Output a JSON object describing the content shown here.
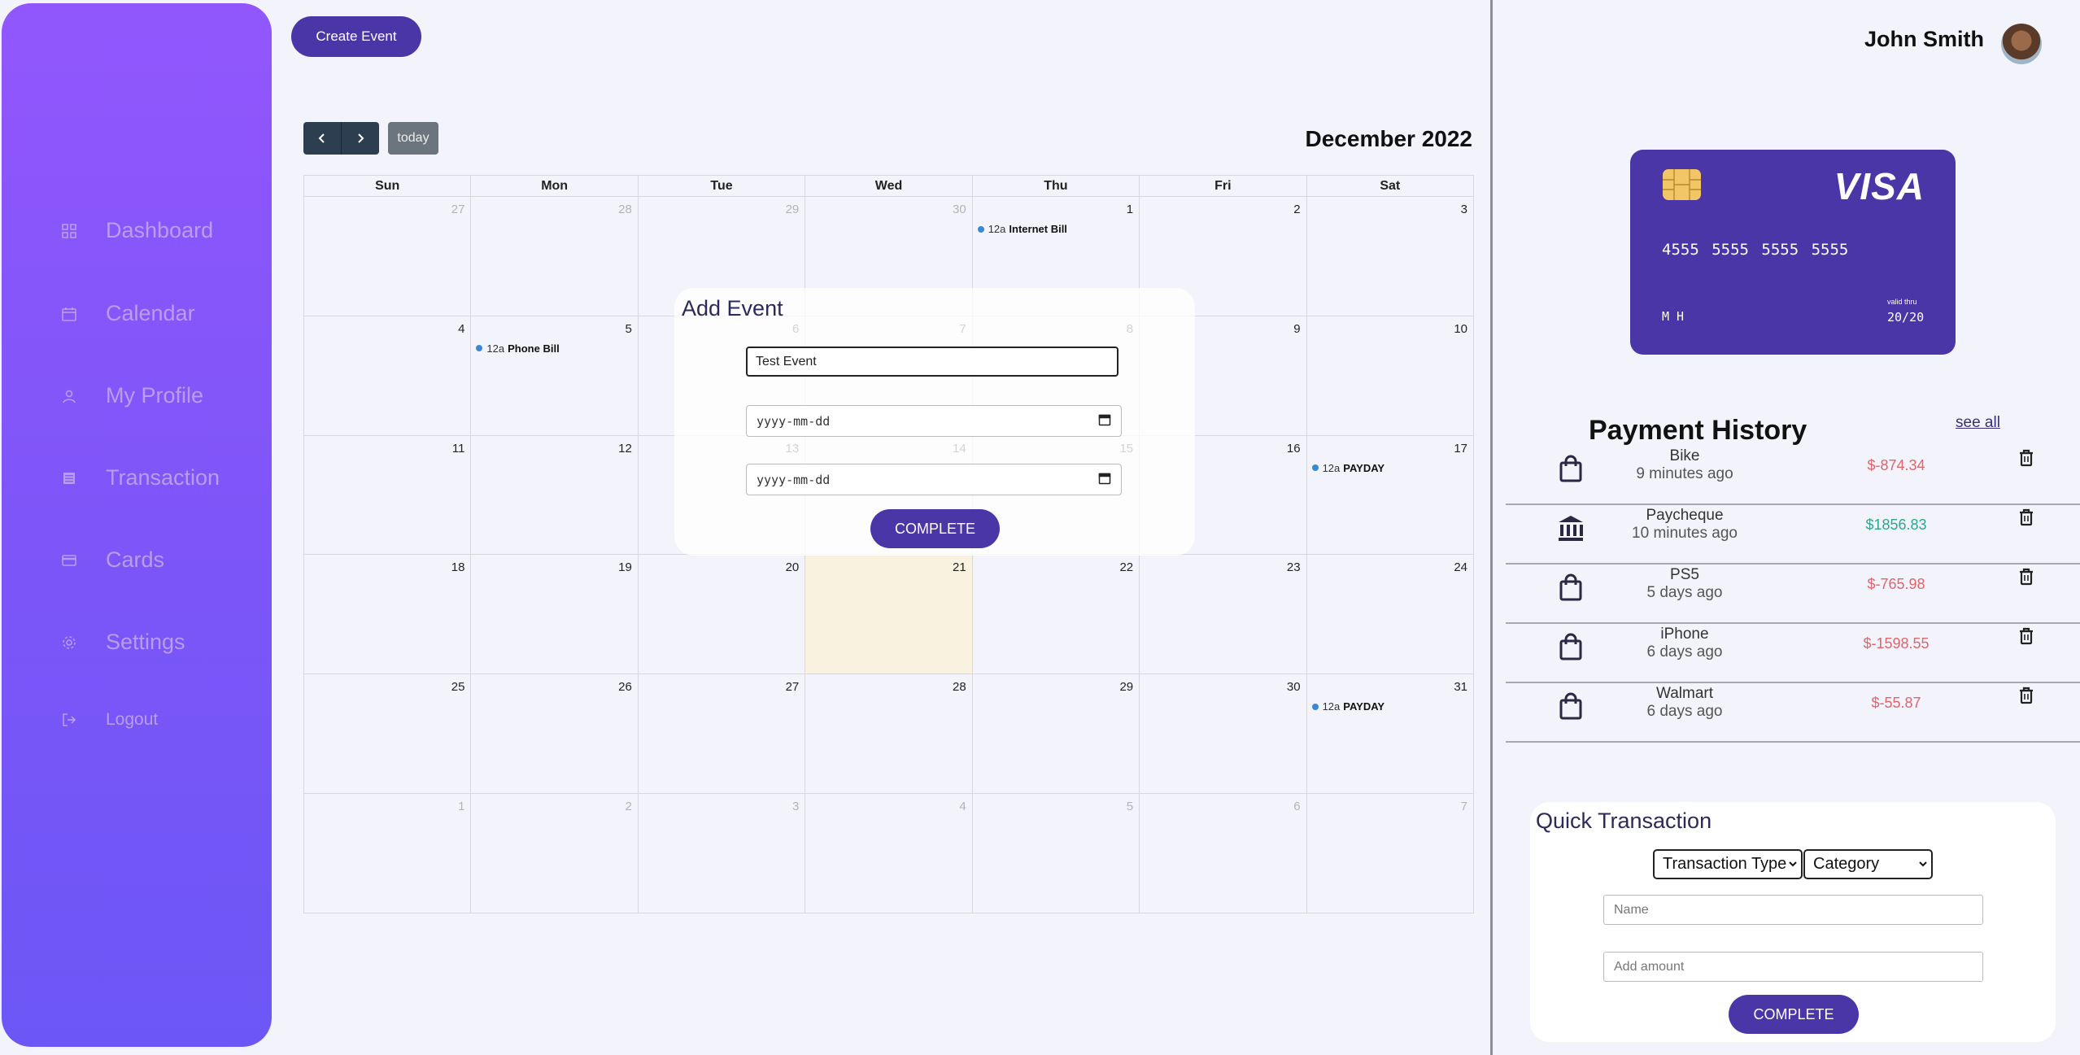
{
  "sidebar": {
    "items": [
      {
        "label": "Dashboard",
        "icon": "grid-icon"
      },
      {
        "label": "Calendar",
        "icon": "calendar-icon"
      },
      {
        "label": "My Profile",
        "icon": "user-icon"
      },
      {
        "label": "Transaction",
        "icon": "list-icon"
      },
      {
        "label": "Cards",
        "icon": "card-icon"
      },
      {
        "label": "Settings",
        "icon": "gear-icon"
      },
      {
        "label": "Logout",
        "icon": "logout-icon"
      }
    ]
  },
  "header": {
    "create_event_label": "Create Event"
  },
  "calendar": {
    "today_label": "today",
    "month_title": "December 2022",
    "weekdays": [
      "Sun",
      "Mon",
      "Tue",
      "Wed",
      "Thu",
      "Fri",
      "Sat"
    ],
    "weeks": [
      [
        "27",
        "28",
        "29",
        "30",
        "1",
        "2",
        "3"
      ],
      [
        "4",
        "5",
        "6",
        "7",
        "8",
        "9",
        "10"
      ],
      [
        "11",
        "12",
        "13",
        "14",
        "15",
        "16",
        "17"
      ],
      [
        "18",
        "19",
        "20",
        "21",
        "22",
        "23",
        "24"
      ],
      [
        "25",
        "26",
        "27",
        "28",
        "29",
        "30",
        "31"
      ],
      [
        "1",
        "2",
        "3",
        "4",
        "5",
        "6",
        "7"
      ]
    ],
    "events": [
      {
        "time": "12a",
        "title": "Internet Bill"
      },
      {
        "time": "12a",
        "title": "Phone Bill"
      },
      {
        "time": "12a",
        "title": "PAYDAY"
      },
      {
        "time": "12a",
        "title": "PAYDAY"
      }
    ]
  },
  "add_event_modal": {
    "title": "Add Event",
    "title_value": "Test Event",
    "start_date_placeholder": "yyyy-mm-dd",
    "end_date_placeholder": "yyyy-mm-dd",
    "complete_label": "COMPLETE"
  },
  "user": {
    "name": "John Smith"
  },
  "card": {
    "brand": "VISA",
    "number": "4555 5555 5555 5555",
    "holder": "M H",
    "valid_label": "valid thru",
    "valid_value": "20/20"
  },
  "payment_history": {
    "title": "Payment History",
    "see_all_label": "see all",
    "items": [
      {
        "name": "Bike",
        "time": "9 minutes ago",
        "amount": "$-874.34",
        "icon": "shopping-bag-icon"
      },
      {
        "name": "Paycheque",
        "time": "10 minutes ago",
        "amount": "$1856.83",
        "icon": "bank-icon"
      },
      {
        "name": "PS5",
        "time": "5 days ago",
        "amount": "$-765.98",
        "icon": "shopping-bag-icon"
      },
      {
        "name": "iPhone",
        "time": "6 days ago",
        "amount": "$-1598.55",
        "icon": "shopping-bag-icon"
      },
      {
        "name": "Walmart",
        "time": "6 days ago",
        "amount": "$-55.87",
        "icon": "shopping-bag-icon"
      }
    ]
  },
  "quick_transaction": {
    "title": "Quick Transaction",
    "type_label": "Transaction Type",
    "category_label": "Category",
    "name_placeholder": "Name",
    "amount_placeholder": "Add amount",
    "complete_label": "COMPLETE"
  }
}
